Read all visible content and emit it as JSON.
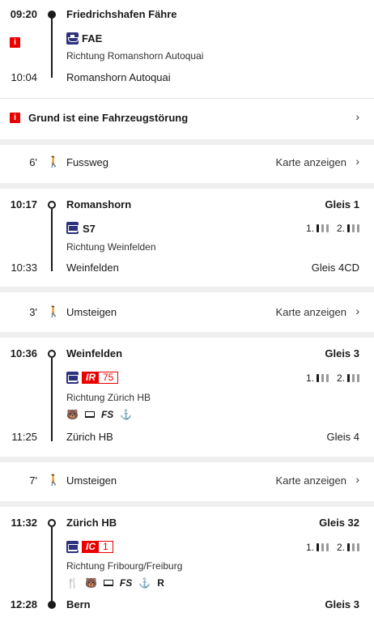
{
  "leg1": {
    "dep_time": "09:20",
    "dep_station": "Friedrichshafen Fähre",
    "line": "FAE",
    "direction": "Richtung Romanshorn Autoquai",
    "arr_time": "10:04",
    "arr_station": "Romanshorn Autoquai",
    "info_icon_label": "i"
  },
  "disruption": {
    "label": "Grund ist eine Fahrzeugstörung",
    "icon_label": "i",
    "chevron": "›"
  },
  "walk1": {
    "duration": "6'",
    "label": "Fussweg",
    "map_link": "Karte anzeigen",
    "chevron": "›"
  },
  "leg2": {
    "dep_time": "10:17",
    "dep_station": "Romanshorn",
    "dep_platform": "Gleis 1",
    "line": "S7",
    "direction": "Richtung Weinfelden",
    "occ_first": "1.",
    "occ_second": "2.",
    "arr_time": "10:33",
    "arr_station": "Weinfelden",
    "arr_platform": "Gleis 4CD"
  },
  "walk2": {
    "duration": "3'",
    "label": "Umsteigen",
    "map_link": "Karte anzeigen",
    "chevron": "›"
  },
  "leg3": {
    "dep_time": "10:36",
    "dep_station": "Weinfelden",
    "dep_platform": "Gleis 3",
    "category": "IR",
    "number": "75",
    "direction": "Richtung Zürich HB",
    "occ_first": "1.",
    "occ_second": "2.",
    "amenity_fs": "FS",
    "arr_time": "11:25",
    "arr_station": "Zürich HB",
    "arr_platform": "Gleis 4"
  },
  "walk3": {
    "duration": "7'",
    "label": "Umsteigen",
    "map_link": "Karte anzeigen",
    "chevron": "›"
  },
  "leg4": {
    "dep_time": "11:32",
    "dep_station": "Zürich HB",
    "dep_platform": "Gleis 32",
    "category": "IC",
    "number": "1",
    "direction": "Richtung Fribourg/Freiburg",
    "occ_first": "1.",
    "occ_second": "2.",
    "amenity_fs": "FS",
    "amenity_r": "R",
    "arr_time": "12:28",
    "arr_station": "Bern",
    "arr_platform": "Gleis 3"
  },
  "colors": {
    "sbb_red": "#eb0000",
    "transport_blue": "#2d327d",
    "separator": "#efefef"
  }
}
